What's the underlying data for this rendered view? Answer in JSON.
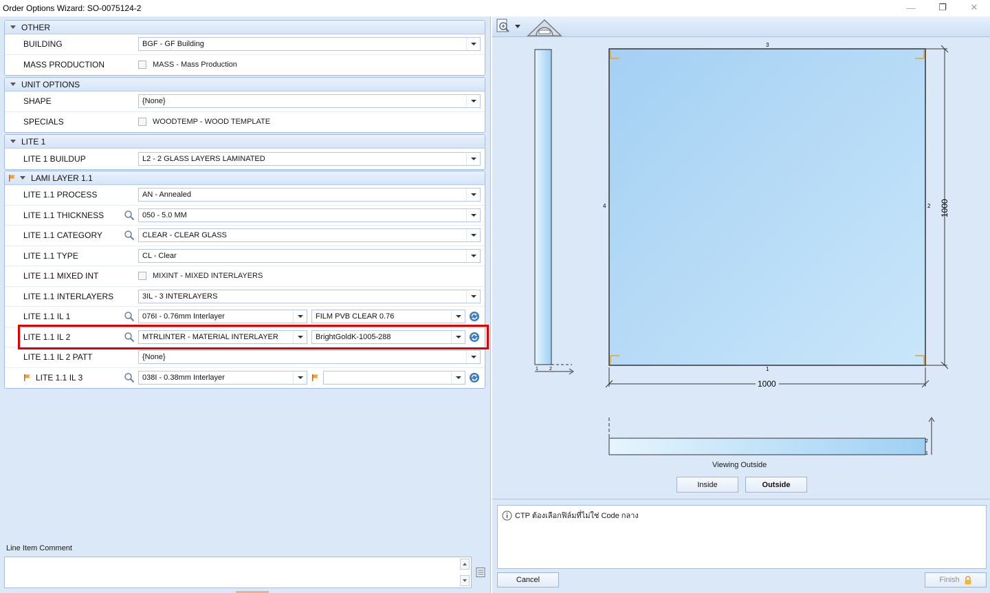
{
  "window": {
    "title": "Order Options Wizard: SO-0075124-2",
    "controls": {
      "minimize": "—",
      "restore": "❐",
      "close": "✕"
    }
  },
  "groups": {
    "other": {
      "header": "OTHER",
      "building_label": "BUILDING",
      "building_value": "BGF - GF Building",
      "mass_label": "MASS PRODUCTION",
      "mass_value": "MASS - Mass Production"
    },
    "unit_options": {
      "header": "UNIT OPTIONS",
      "shape_label": "SHAPE",
      "shape_value": "{None}",
      "specials_label": "SPECIALS",
      "specials_value": "WOODTEMP - WOOD TEMPLATE"
    },
    "lite1": {
      "header": "LITE 1",
      "buildup_label": "LITE 1 BUILDUP",
      "buildup_value": "L2 - 2 GLASS LAYERS LAMINATED"
    },
    "lami": {
      "header": "LAMI LAYER 1.1",
      "rows": [
        {
          "label": "LITE 1.1 PROCESS",
          "value": "AN - Annealed"
        },
        {
          "label": "LITE 1.1 THICKNESS",
          "value": "050 - 5.0 MM"
        },
        {
          "label": "LITE 1.1 CATEGORY",
          "value": "CLEAR - CLEAR GLASS"
        },
        {
          "label": "LITE 1.1 TYPE",
          "value": "CL - Clear"
        },
        {
          "label": "LITE 1.1 MIXED INT",
          "value": "MIXINT - MIXED INTERLAYERS"
        },
        {
          "label": "LITE 1.1 INTERLAYERS",
          "value": "3IL - 3 INTERLAYERS"
        },
        {
          "label": "LITE 1.1 IL 1",
          "value": "076I - 0.76mm Interlayer",
          "value2": "FILM PVB CLEAR 0.76"
        },
        {
          "label": "LITE 1.1 IL 2",
          "value": "MTRLINTER - MATERIAL INTERLAYER",
          "value2": "BrightGoldK-1005-288"
        },
        {
          "label": "LITE 1.1 IL 2 PATT",
          "value": "{None}"
        },
        {
          "label": "LITE 1.1 IL 3",
          "value": "038I - 0.38mm Interlayer",
          "value2": ""
        }
      ]
    }
  },
  "comment": {
    "label": "Line Item Comment",
    "value": ""
  },
  "preview": {
    "dims": {
      "top": "3",
      "bottom": "1",
      "left": "4",
      "right": "2",
      "height": "1000",
      "width": "1000",
      "side_a": "1",
      "side_b": "2"
    },
    "viewing_label": "Viewing Outside",
    "inside_label": "Inside",
    "outside_label": "Outside"
  },
  "message": {
    "text": "CTP ต้องเลือกฟิล์มที่ไม่ใช่ Code กลาง"
  },
  "footer": {
    "cancel_label": "Cancel",
    "finish_label": "Finish"
  },
  "colors": {
    "accent": "#e00000",
    "pane_bg": "#dbe8f7",
    "glass_fill": "#a9d6f6",
    "corner_marker": "#f0a020"
  }
}
